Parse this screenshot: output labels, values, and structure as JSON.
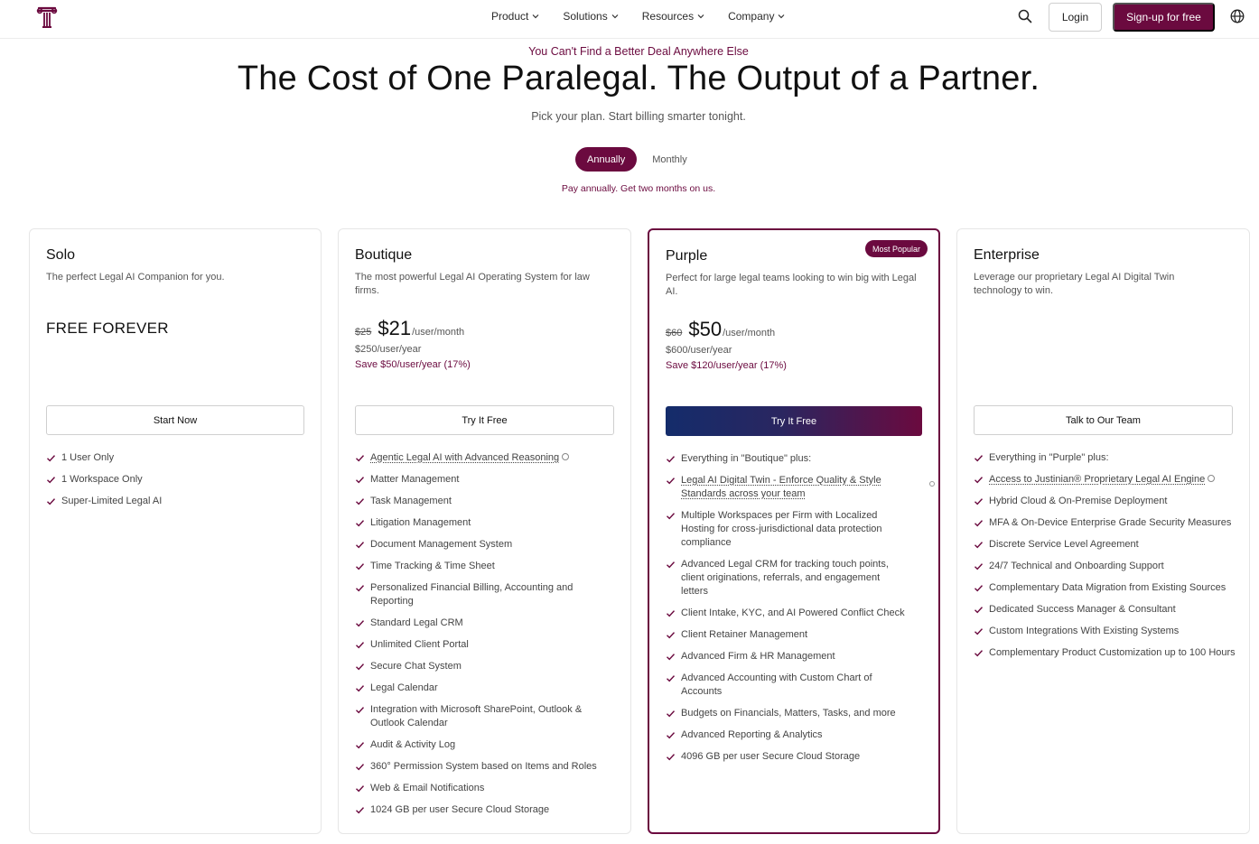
{
  "nav": {
    "menu": [
      {
        "label": "Product"
      },
      {
        "label": "Solutions"
      },
      {
        "label": "Resources"
      },
      {
        "label": "Company"
      }
    ],
    "login_label": "Login",
    "signup_label": "Sign-up for free"
  },
  "hero": {
    "eyebrow": "You Can't Find a Better Deal Anywhere Else",
    "headline": "The Cost of One Paralegal. The Output of a Partner.",
    "subline": "Pick your plan. Start billing smarter tonight.",
    "toggle": {
      "annual_label": "Annually",
      "monthly_label": "Monthly",
      "selected": "Annually",
      "note": "Pay annually. Get two months on us."
    }
  },
  "plans": {
    "solo": {
      "title": "Solo",
      "description": "The perfect Legal AI Companion for you.",
      "price_label": "FREE FOREVER",
      "cta": "Start Now",
      "features": [
        "1 User Only",
        "1 Workspace Only",
        "Super-Limited Legal AI"
      ]
    },
    "boutique": {
      "title": "Boutique",
      "description": "The most powerful Legal AI Operating System for law firms.",
      "price_old": "$25",
      "price_now": "$21",
      "price_unit": "/user/month",
      "price_year": "$250/user/year",
      "price_save": "Save $50/user/year (17%)",
      "cta": "Try It Free",
      "features": [
        "Agentic Legal AI with Advanced Reasoning",
        "Matter Management",
        "Task Management",
        "Litigation Management",
        "Document Management System",
        "Time Tracking & Time Sheet",
        "Personalized Financial Billing, Accounting and Reporting",
        "Standard Legal CRM",
        "Unlimited Client Portal",
        "Secure Chat System",
        "Legal Calendar",
        "Integration with Microsoft SharePoint, Outlook & Outlook Calendar",
        "Audit & Activity Log",
        "360° Permission System based on Items and Roles",
        "Web & Email Notifications",
        "1024 GB per user Secure Cloud Storage"
      ]
    },
    "purple": {
      "title": "Purple",
      "badge": "Most Popular",
      "description": "Perfect for large legal teams looking to win big with Legal AI.",
      "price_old": "$60",
      "price_now": "$50",
      "price_unit": "/user/month",
      "price_year": "$600/user/year",
      "price_save": "Save $120/user/year (17%)",
      "cta": "Try It Free",
      "features": [
        "Everything in \"Boutique\" plus:",
        "Legal AI Digital Twin - Enforce Quality & Style Standards across your team",
        "Multiple Workspaces per Firm with Localized Hosting for cross-jurisdictional data protection compliance",
        "Advanced Legal CRM for tracking touch points, client originations, referrals, and engagement letters",
        "Client Intake, KYC, and AI Powered Conflict Check",
        "Client Retainer Management",
        "Advanced Firm & HR Management",
        "Advanced Accounting with Custom Chart of Accounts",
        "Budgets on Financials, Matters, Tasks, and more",
        "Advanced Reporting & Analytics",
        "4096 GB per user Secure Cloud Storage"
      ]
    },
    "enterprise": {
      "title": "Enterprise",
      "description": "Leverage our proprietary Legal AI Digital Twin technology to win.",
      "cta": "Talk to Our Team",
      "features": [
        "Everything in \"Purple\" plus:",
        "Access to Justinian® Proprietary Legal AI Engine",
        "Hybrid Cloud & On-Premise Deployment",
        "MFA & On-Device Enterprise Grade Security Measures",
        "Discrete Service Level Agreement",
        "24/7 Technical and Onboarding Support",
        "Complementary Data Migration from Existing Sources",
        "Dedicated Success Manager & Consultant",
        "Custom Integrations With Existing Systems",
        "Complementary Product Customization up to 100 Hours"
      ]
    }
  },
  "colors": {
    "brand": "#6b0a3f",
    "gradient_start": "#142c6b",
    "gradient_end": "#6b0a3f",
    "text": "#111111",
    "muted": "#555555"
  },
  "icons": {
    "logo": "pillar-logo-icon",
    "search": "search-icon",
    "globe": "globe-icon",
    "check": "check-icon",
    "info": "info-icon",
    "chevron": "chevron-down-icon"
  }
}
